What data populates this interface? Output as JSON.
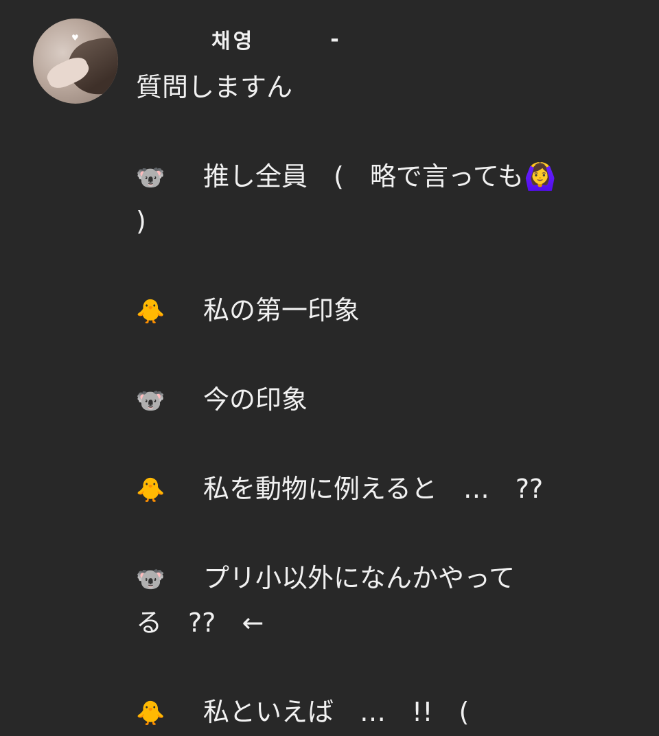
{
  "post": {
    "author": "채영",
    "separator": "-",
    "avatar_icon": "heart-icon",
    "avatar_heart": "♥",
    "lines": [
      {
        "emoji": "",
        "text": "質問しますん"
      },
      {
        "emoji": "🐨",
        "text": "推し全員　(　略で言っても🙆‍♀️"
      },
      {
        "emoji": "",
        "text": ")"
      },
      {
        "emoji": "🐥",
        "text": "私の第一印象"
      },
      {
        "emoji": "🐨",
        "text": "今の印象"
      },
      {
        "emoji": "🐥",
        "text": "私を動物に例えると　…　??"
      },
      {
        "emoji": "🐨",
        "text": "プリ小以外になんかやって"
      },
      {
        "emoji": "",
        "text": "る　??　←"
      },
      {
        "emoji": "🐥",
        "text": "私といえば　…　!!　("
      }
    ]
  }
}
